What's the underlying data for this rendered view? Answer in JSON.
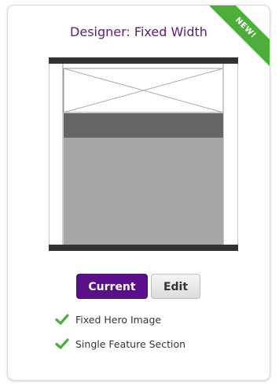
{
  "card": {
    "title": "Designer: Fixed Width",
    "badge": "NEW!",
    "buttons": {
      "current_label": "Current",
      "edit_label": "Edit"
    },
    "features": [
      {
        "label": "Fixed Hero Image",
        "icon": "check-icon"
      },
      {
        "label": "Single Feature Section",
        "icon": "check-icon"
      }
    ]
  },
  "colors": {
    "title": "#5b1a86",
    "current_button": "#5b1089",
    "badge": "#4caf3a",
    "check": "#4caf3a"
  }
}
